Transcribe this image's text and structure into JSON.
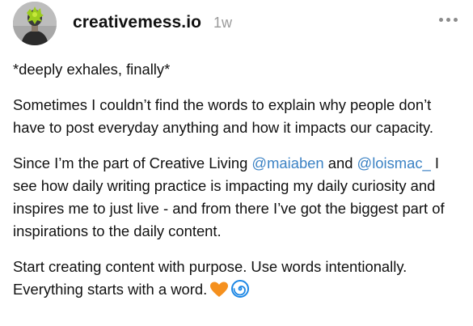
{
  "post": {
    "author": {
      "username": "creativemess.io",
      "time_ago": "1w",
      "avatar_icon": "profile-photo"
    },
    "more_icon": "ellipsis-icon",
    "paragraphs": {
      "p1": "*deeply exhales, finally*",
      "p2": "Sometimes I couldn’t find the words to explain why people don’t have to post everyday anything and how it impacts our capacity.",
      "p3_a": "Since I’m the part of Creative Living ",
      "p3_mention1": "@maiaben",
      "p3_b": " and ",
      "p3_mention2": "@loismac_",
      "p3_c": " I see how daily writing practice is impacting my daily curiosity and inspires me to just live - and from there I’ve got the biggest part of inspirations to the daily content.",
      "p4": "Start creating content with purpose. Use words intentionally. Everything starts with a word."
    },
    "emojis": [
      "orange-heart-icon",
      "spiral-icon"
    ],
    "colors": {
      "text": "#111111",
      "muted": "#9a9a9a",
      "mention": "#3b82c4",
      "heart": "#f5901e",
      "spiral": "#1e88e5"
    }
  }
}
